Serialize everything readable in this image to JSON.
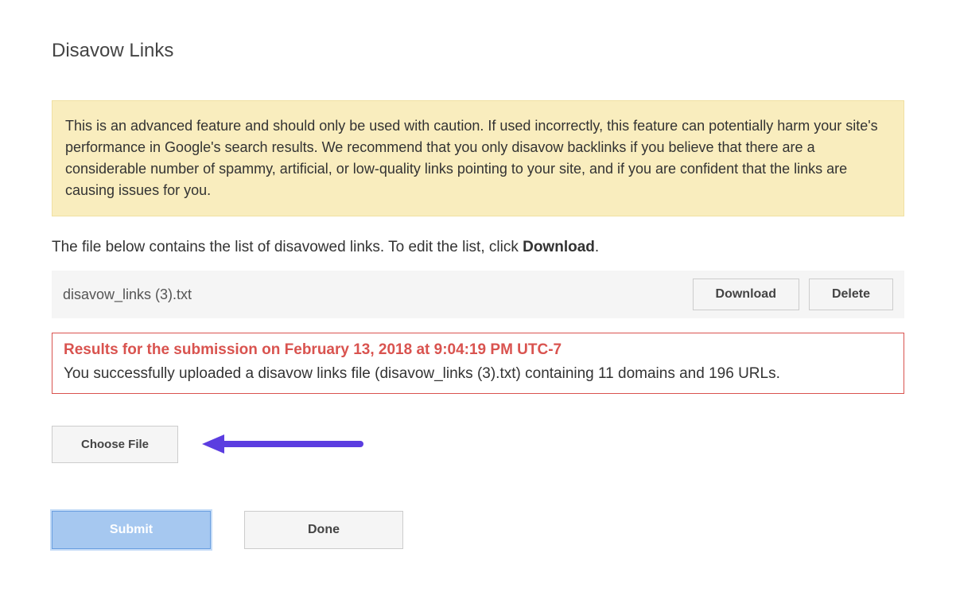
{
  "page": {
    "title": "Disavow Links"
  },
  "warning": {
    "text": "This is an advanced feature and should only be used with caution. If used incorrectly, this feature can potentially harm your site's performance in Google's search results. We recommend that you only disavow backlinks if you believe that there are a considerable number of spammy, artificial, or low-quality links pointing to your site, and if you are confident that the links are causing issues for you."
  },
  "description": {
    "prefix": "The file below contains the list of disavowed links. To edit the list, click ",
    "bold": "Download",
    "suffix": "."
  },
  "file": {
    "name": "disavow_links (3).txt",
    "download_label": "Download",
    "delete_label": "Delete"
  },
  "results": {
    "title": "Results for the submission on February 13, 2018 at 9:04:19 PM UTC-7",
    "body": "You successfully uploaded a disavow links file (disavow_links (3).txt) containing 11 domains and 196 URLs."
  },
  "actions": {
    "choose_file_label": "Choose File",
    "submit_label": "Submit",
    "done_label": "Done"
  },
  "annotation": {
    "arrow_color": "#5b3de0"
  }
}
